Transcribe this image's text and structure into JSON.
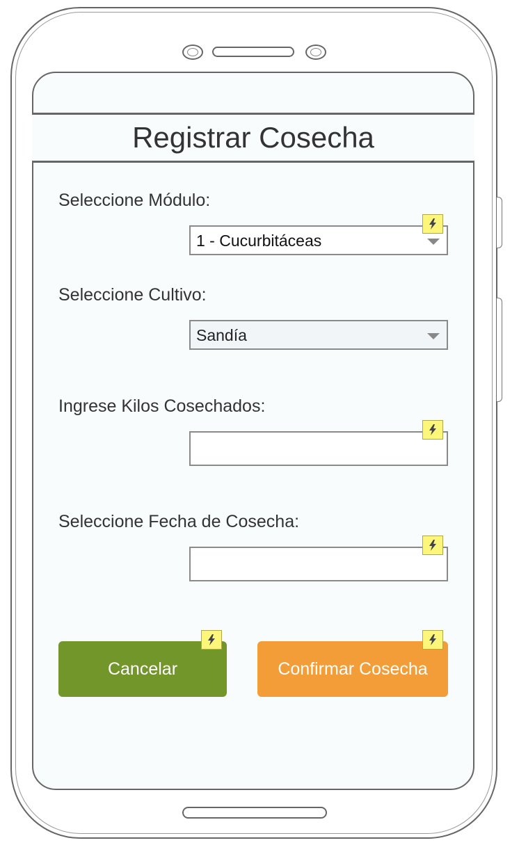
{
  "screen": {
    "title": "Registrar Cosecha"
  },
  "form": {
    "modulo": {
      "label": "Seleccione Módulo:",
      "value": "1 - Cucurbitáceas"
    },
    "cultivo": {
      "label": "Seleccione Cultivo:",
      "value": "Sandía"
    },
    "kilos": {
      "label": "Ingrese Kilos Cosechados:",
      "value": ""
    },
    "fecha": {
      "label": "Seleccione Fecha de Cosecha:",
      "value": ""
    }
  },
  "buttons": {
    "cancel": {
      "label": "Cancelar",
      "color": "#72962a"
    },
    "confirm": {
      "label": "Confirmar Cosecha",
      "color": "#f29d38"
    }
  },
  "icons": {
    "action_marker": "lightning-bolt-icon"
  }
}
